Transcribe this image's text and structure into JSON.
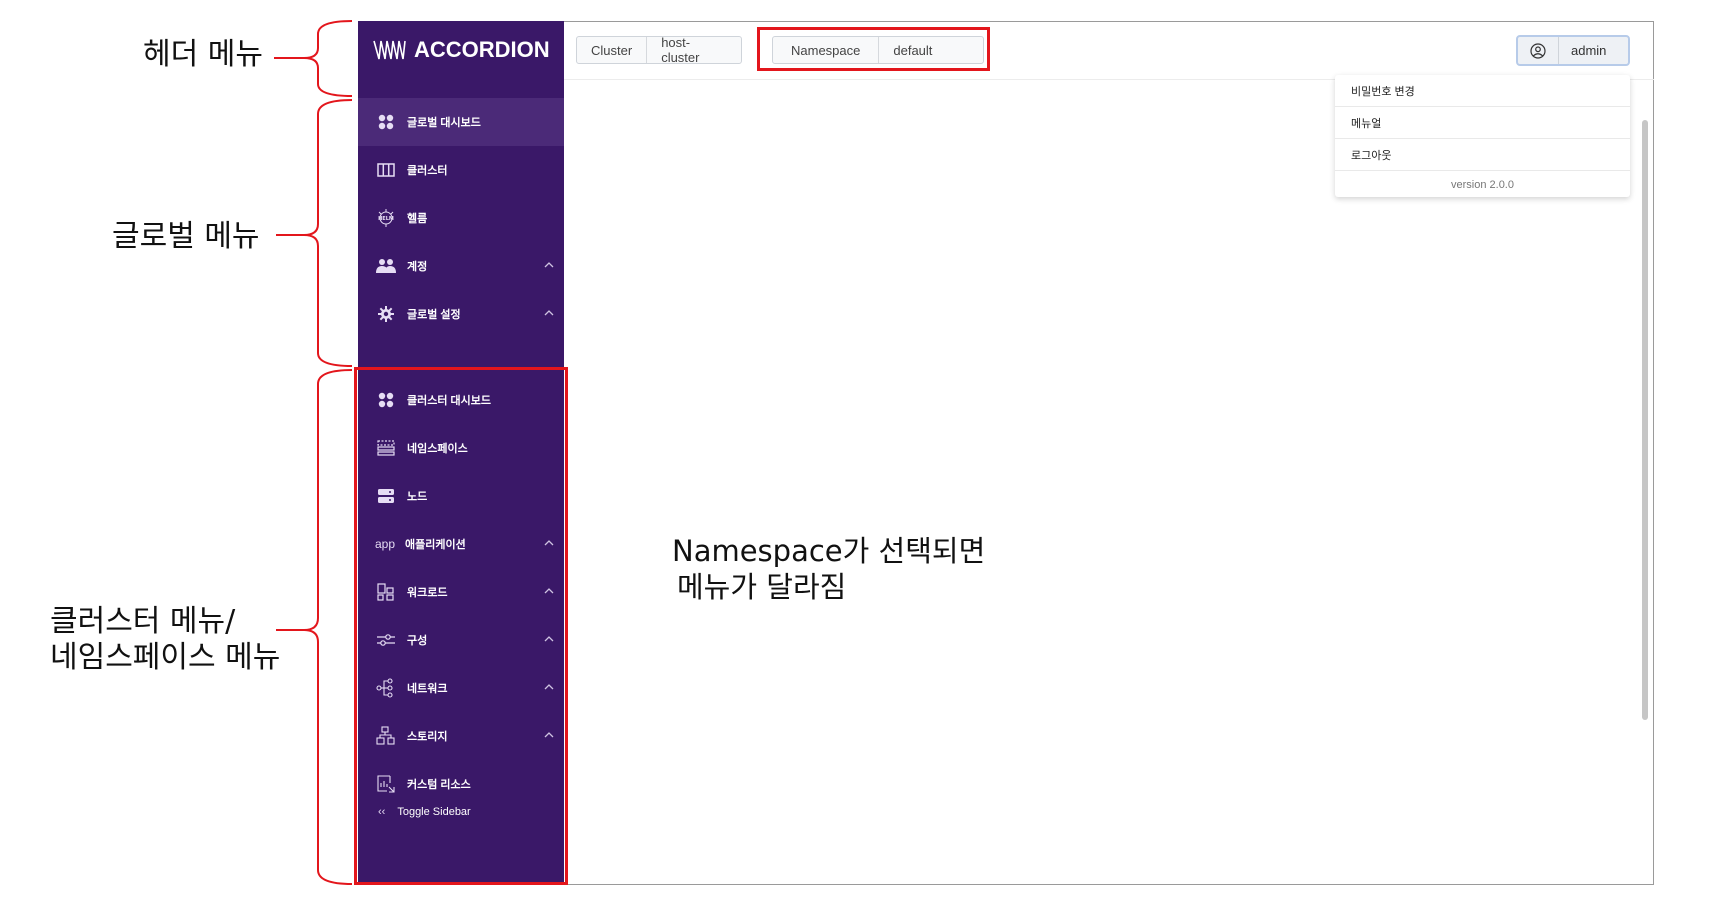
{
  "annotations": {
    "header_menu": "헤더 메뉴",
    "global_menu": "글로벌 메뉴",
    "cluster_menu_line1": "클러스터 메뉴/",
    "cluster_menu_line2": "네임스페이스 메뉴",
    "namespace_note_line1": "Namespace가 선택되면",
    "namespace_note_line2": "메뉴가 달라짐",
    "highlight_color": "#e3161c"
  },
  "app": {
    "logo": "ACCORDION",
    "sidebar_color": "#3a1868"
  },
  "header": {
    "cluster_label": "Cluster",
    "cluster_value": "host-cluster",
    "namespace_label": "Namespace",
    "namespace_value": "default",
    "user": "admin"
  },
  "user_menu": {
    "items": [
      "비밀번호 변경",
      "메뉴얼",
      "로그아웃"
    ],
    "version": "version 2.0.0"
  },
  "global_menu": [
    {
      "label": "글로벌 대시보드",
      "icon": "dashboard-icon",
      "active": true
    },
    {
      "label": "클러스터",
      "icon": "cluster-icon"
    },
    {
      "label": "헬름",
      "icon": "helm-icon"
    },
    {
      "label": "계정",
      "icon": "users-icon",
      "expandable": true
    },
    {
      "label": "글로벌 설정",
      "icon": "gear-icon",
      "expandable": true
    }
  ],
  "cluster_menu": [
    {
      "label": "클러스터 대시보드",
      "icon": "dashboard-icon"
    },
    {
      "label": "네임스페이스",
      "icon": "namespace-icon"
    },
    {
      "label": "노드",
      "icon": "server-icon"
    },
    {
      "label": "애플리케이션",
      "icon_text": "app",
      "expandable": true
    },
    {
      "label": "워크로드",
      "icon": "workload-icon",
      "expandable": true
    },
    {
      "label": "구성",
      "icon": "sliders-icon",
      "expandable": true
    },
    {
      "label": "네트워크",
      "icon": "network-icon",
      "expandable": true
    },
    {
      "label": "스토리지",
      "icon": "storage-icon",
      "expandable": true
    },
    {
      "label": "커스텀 리소스",
      "icon": "custom-resource-icon"
    }
  ],
  "toggle_sidebar": "Toggle Sidebar"
}
